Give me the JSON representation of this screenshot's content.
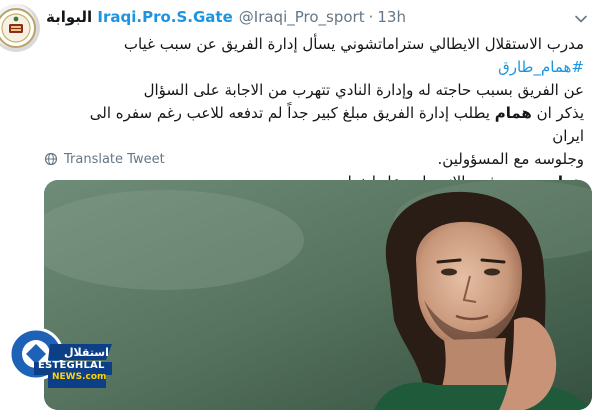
{
  "tweet": {
    "display_name_arabic": "البوابة",
    "display_name_latin": "Iraqi.Pro.S.Gate",
    "handle": "@Iraqi_Pro_sport",
    "separator": "·",
    "time": "13h",
    "lines": [
      "مدرب الاستقلال الايطالي ستراماتشوني يسأل إدارة الفريق عن سبب غياب ",
      "عن الفريق بسبب حاجته له وإدارة النادي تتهرب من الاجابة على السؤال",
      "يذكر ان ",
      "وجلوسه مع المسؤولين.",
      "بدوره رفض الانضمام وعاد لبغداد"
    ],
    "hashtag": "#همام_طارق",
    "line3_bold": "همام",
    "line3_rest": " يطلب إدارة الفريق مبلغ كبير جداً لم تدفعه للاعب رغم سفره الى ايران",
    "line5_bold": "همام",
    "translate_label": "Translate Tweet"
  },
  "watermark": {
    "word1": "ESTEGHLAL",
    "word2": "NEWS.com"
  },
  "colors": {
    "link": "#1b95e0",
    "muted": "#657786",
    "text": "#14171a"
  },
  "icons": {
    "caret": "chevron-down-icon",
    "translate": "globe-icon"
  }
}
